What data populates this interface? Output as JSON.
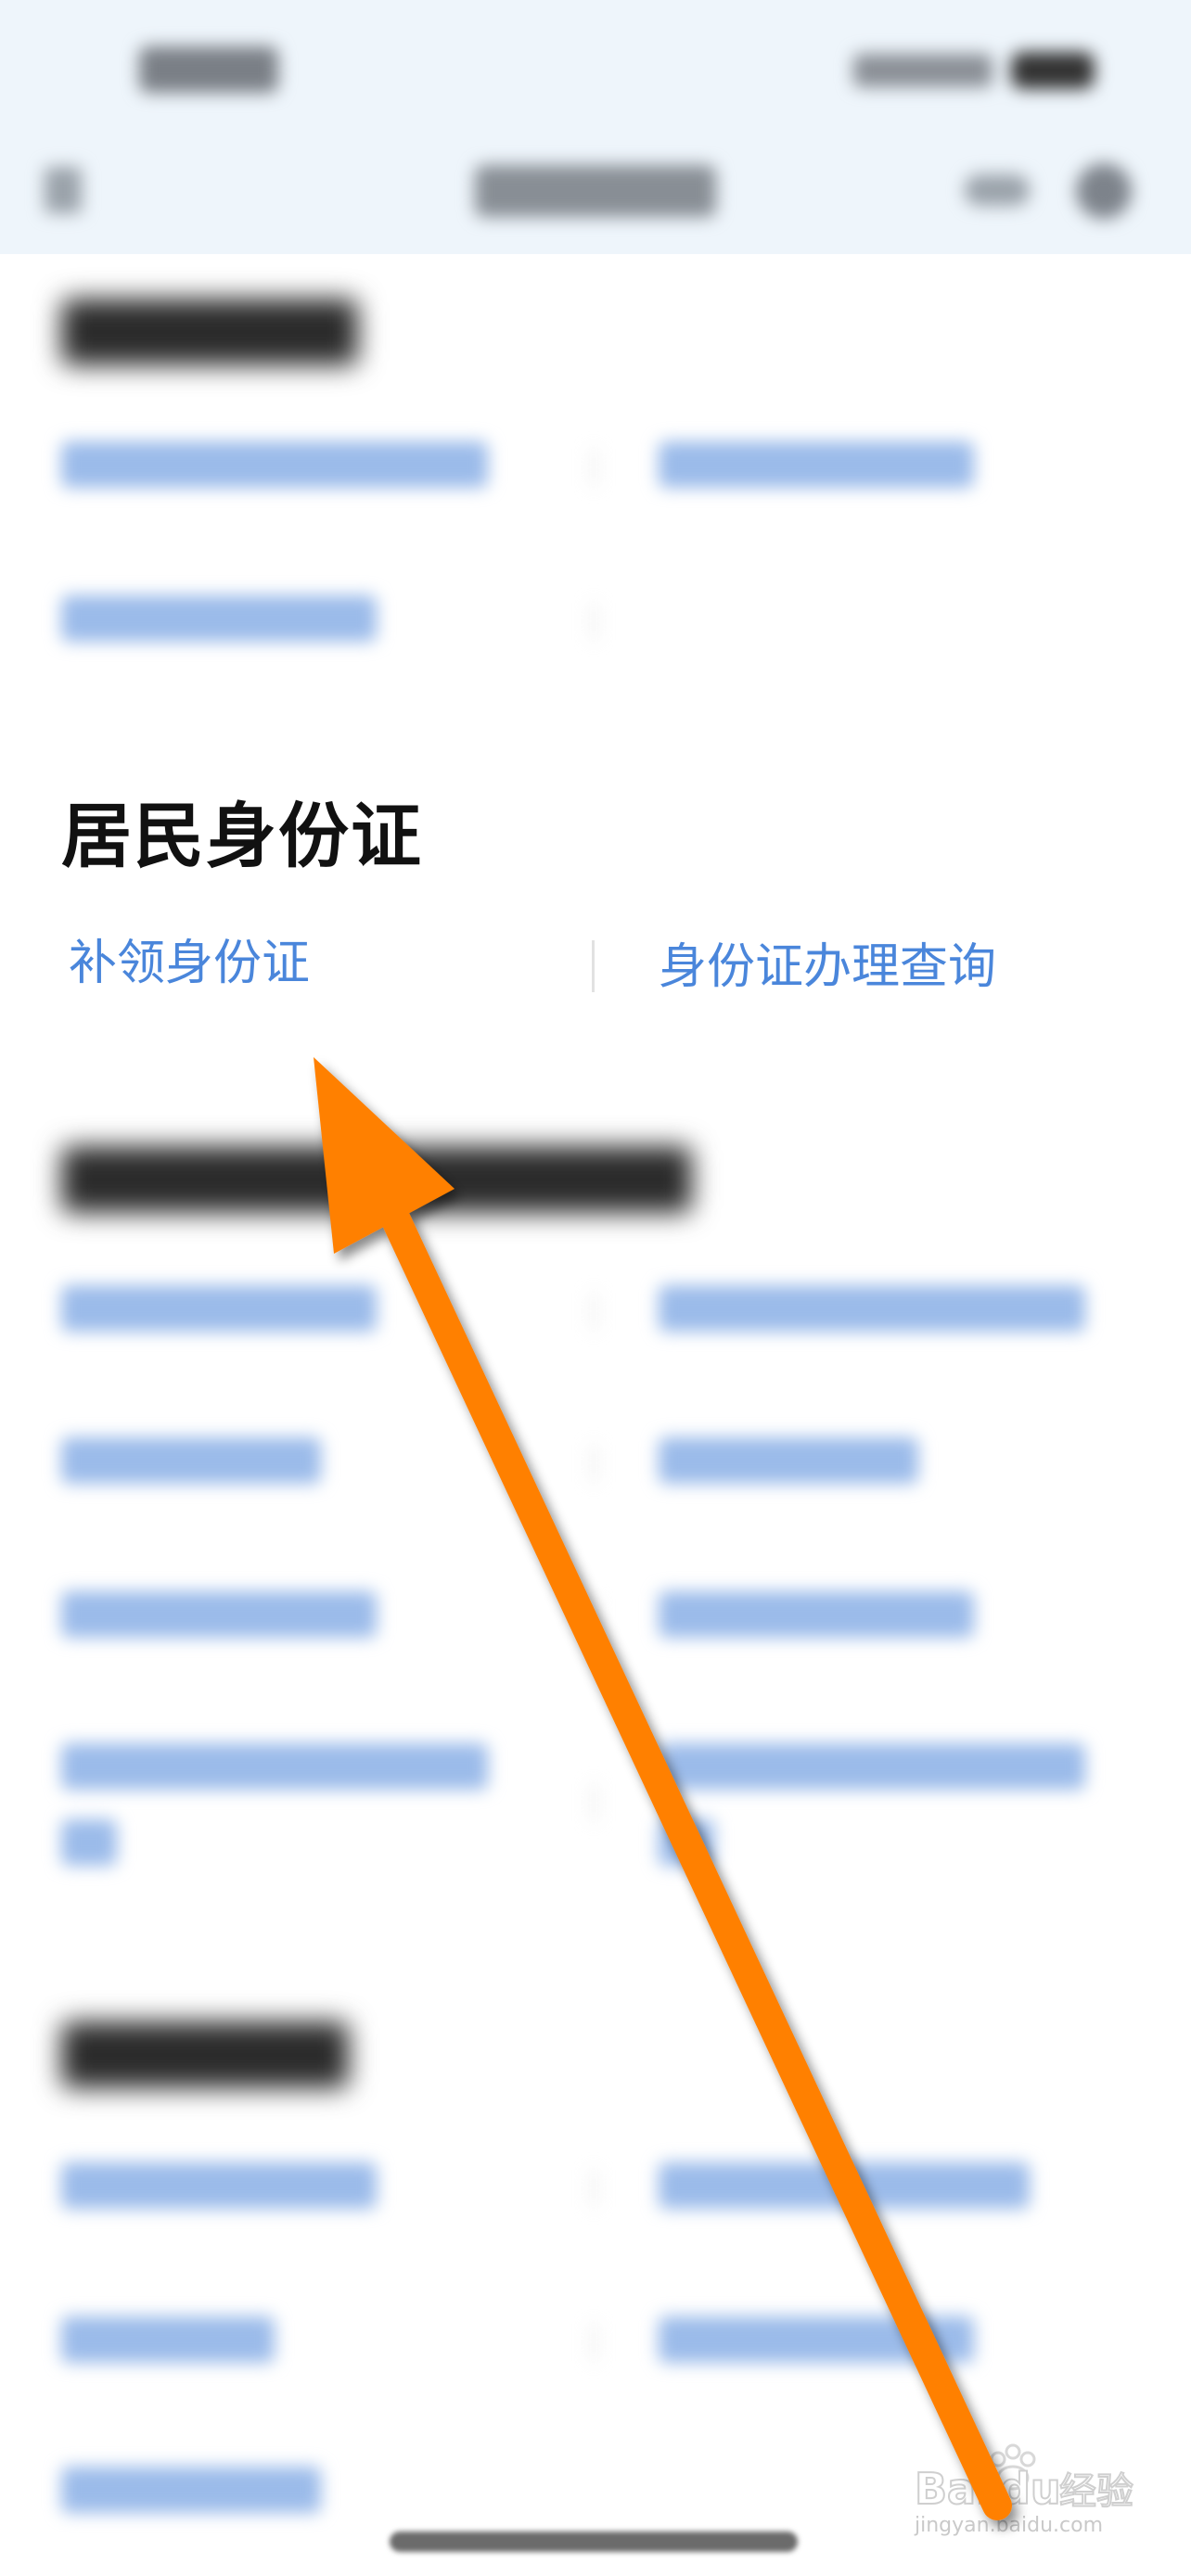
{
  "section": {
    "title": "居民身份证",
    "links": [
      {
        "label": "补领身份证"
      },
      {
        "label": "身份证办理查询"
      }
    ]
  },
  "watermark": {
    "brand": "Bai du 经验",
    "url": "jingyan.baidu.com"
  },
  "annotation": {
    "arrow_color": "#ff8000"
  },
  "colors": {
    "header_bg": "#eef5fb",
    "link": "#4a86db",
    "title": "#111111"
  }
}
